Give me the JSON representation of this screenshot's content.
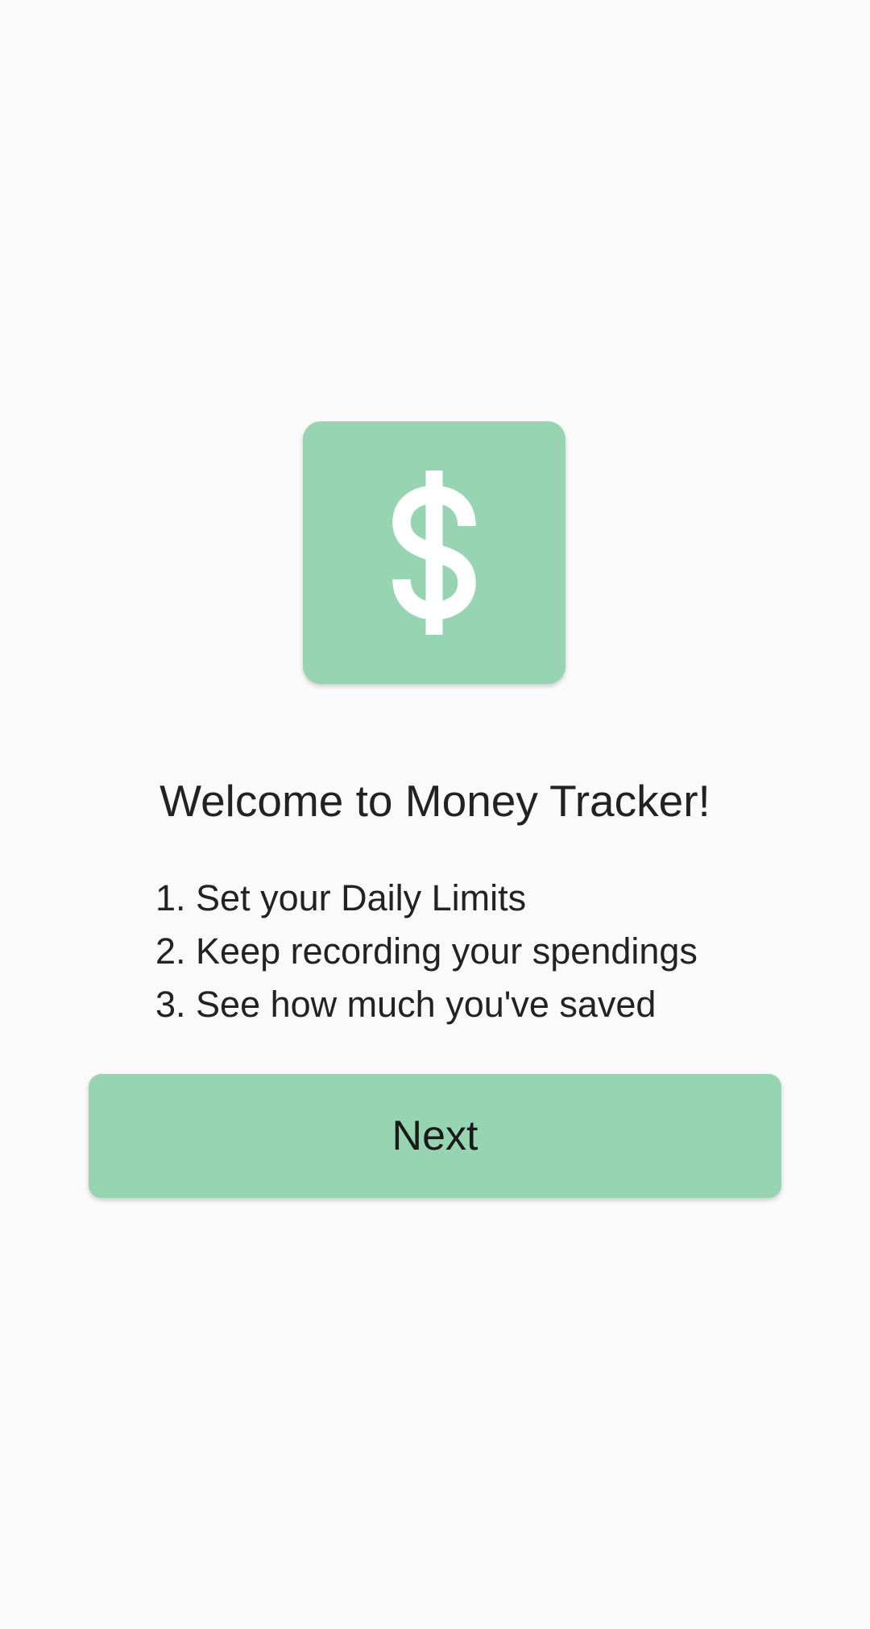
{
  "theme": {
    "accent": "#97d5b2",
    "background": "#fafafa",
    "icon_color": "#ffffff",
    "text_color": "#222222"
  },
  "logo": {
    "icon": "dollar-sign-icon"
  },
  "welcome": {
    "title": "Welcome to Money Tracker!",
    "steps": [
      "1. Set your Daily Limits",
      "2. Keep recording your spendings",
      "3. See how much you've saved"
    ]
  },
  "actions": {
    "next_label": "Next"
  }
}
